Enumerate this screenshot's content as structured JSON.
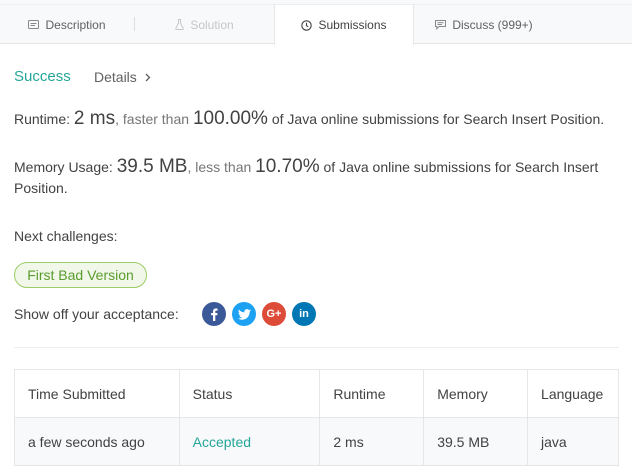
{
  "tabs": [
    {
      "label": "Description",
      "icon": "description-icon",
      "state": "normal"
    },
    {
      "label": "Solution",
      "icon": "flask-icon",
      "state": "disabled"
    },
    {
      "label": "Submissions",
      "icon": "clock-icon",
      "state": "active"
    },
    {
      "label": "Discuss (999+)",
      "icon": "chat-icon",
      "state": "normal"
    }
  ],
  "result": {
    "status": "Success",
    "details_label": "Details"
  },
  "runtime": {
    "prefix": "Runtime: ",
    "value": "2 ms",
    "mid": ", faster than ",
    "percent": "100.00%",
    "suffix": " of Java online submissions for Search Insert Position."
  },
  "memory": {
    "prefix": "Memory Usage: ",
    "value": "39.5 MB",
    "mid": ", less than ",
    "percent": "10.70%",
    "suffix": " of Java online submissions for Search Insert Position."
  },
  "next": {
    "label": "Next challenges:",
    "challenges": [
      "First Bad Version"
    ]
  },
  "share": {
    "label": "Show off your acceptance:",
    "networks": [
      "facebook-icon",
      "twitter-icon",
      "google-plus-icon",
      "linkedin-icon"
    ]
  },
  "submissions_table": {
    "headers": [
      "Time Submitted",
      "Status",
      "Runtime",
      "Memory",
      "Language"
    ],
    "rows": [
      [
        "a few seconds ago",
        "Accepted",
        "2 ms",
        "39.5 MB",
        "java"
      ]
    ]
  },
  "colors": {
    "accent_green": "#26a69a",
    "challenge_green": "#5a9c2e",
    "facebook": "#3b5998",
    "twitter": "#1da1f2",
    "google_plus": "#dd4b39",
    "linkedin": "#0077b5"
  }
}
